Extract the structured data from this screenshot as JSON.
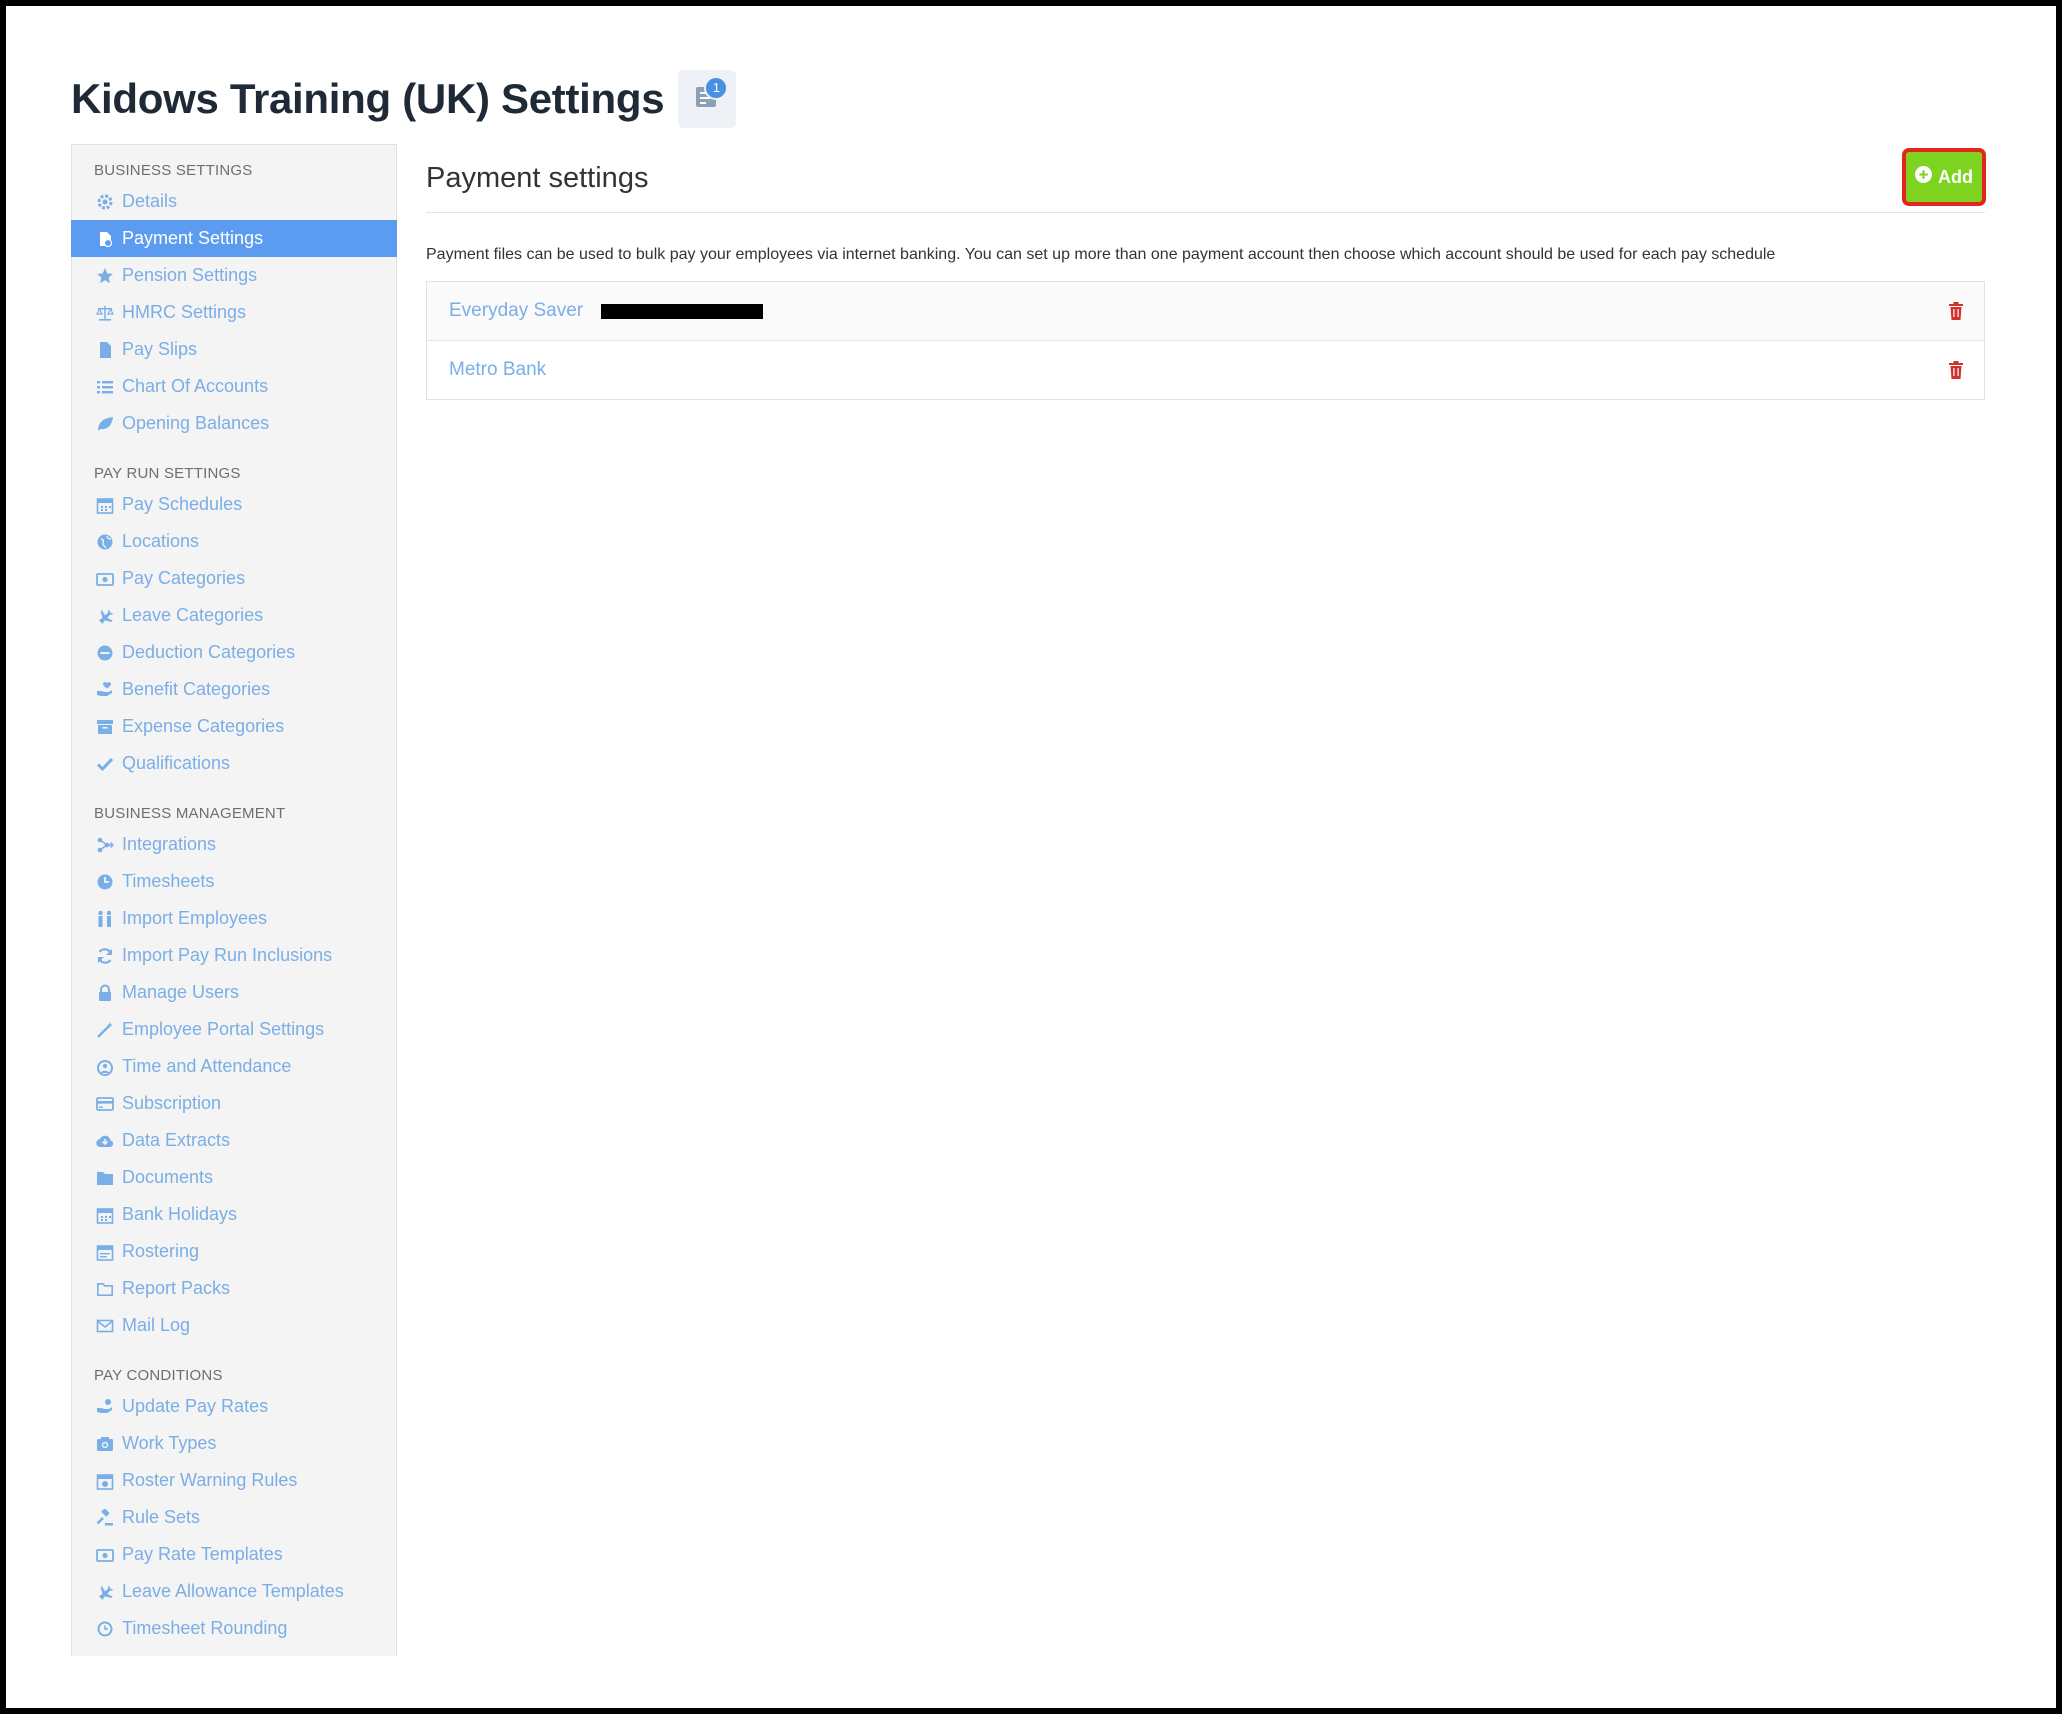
{
  "page": {
    "title": "Kidows Training (UK) Settings",
    "notification_count": "1"
  },
  "sidebar": {
    "sections": [
      {
        "title": "BUSINESS SETTINGS",
        "items": [
          {
            "label": "Details",
            "icon": "gear-icon"
          },
          {
            "label": "Payment Settings",
            "icon": "payment-settings-icon",
            "active": true
          },
          {
            "label": "Pension Settings",
            "icon": "star-icon"
          },
          {
            "label": "HMRC Settings",
            "icon": "scales-icon"
          },
          {
            "label": "Pay Slips",
            "icon": "file-icon"
          },
          {
            "label": "Chart Of Accounts",
            "icon": "list-icon"
          },
          {
            "label": "Opening Balances",
            "icon": "leaf-icon"
          }
        ]
      },
      {
        "title": "PAY RUN SETTINGS",
        "items": [
          {
            "label": "Pay Schedules",
            "icon": "calendar-icon"
          },
          {
            "label": "Locations",
            "icon": "globe-icon"
          },
          {
            "label": "Pay Categories",
            "icon": "money-icon"
          },
          {
            "label": "Leave Categories",
            "icon": "plane-icon"
          },
          {
            "label": "Deduction Categories",
            "icon": "minus-circle-icon"
          },
          {
            "label": "Benefit Categories",
            "icon": "hand-heart-icon"
          },
          {
            "label": "Expense Categories",
            "icon": "archive-icon"
          },
          {
            "label": "Qualifications",
            "icon": "check-icon"
          }
        ]
      },
      {
        "title": "BUSINESS MANAGEMENT",
        "items": [
          {
            "label": "Integrations",
            "icon": "integration-icon"
          },
          {
            "label": "Timesheets",
            "icon": "clock-icon"
          },
          {
            "label": "Import Employees",
            "icon": "users-icon"
          },
          {
            "label": "Import Pay Run Inclusions",
            "icon": "refresh-icon"
          },
          {
            "label": "Manage Users",
            "icon": "lock-icon"
          },
          {
            "label": "Employee Portal Settings",
            "icon": "wand-icon"
          },
          {
            "label": "Time and Attendance",
            "icon": "user-clock-icon"
          },
          {
            "label": "Subscription",
            "icon": "credit-card-icon"
          },
          {
            "label": "Data Extracts",
            "icon": "cloud-download-icon"
          },
          {
            "label": "Documents",
            "icon": "folder-icon"
          },
          {
            "label": "Bank Holidays",
            "icon": "calendar-icon"
          },
          {
            "label": "Rostering",
            "icon": "roster-calendar-icon"
          },
          {
            "label": "Report Packs",
            "icon": "folder-outline-icon"
          },
          {
            "label": "Mail Log",
            "icon": "envelope-icon"
          }
        ]
      },
      {
        "title": "PAY CONDITIONS",
        "items": [
          {
            "label": "Update Pay Rates",
            "icon": "hand-coin-icon"
          },
          {
            "label": "Work Types",
            "icon": "camera-icon"
          },
          {
            "label": "Roster Warning Rules",
            "icon": "calendar-warning-icon"
          },
          {
            "label": "Rule Sets",
            "icon": "gavel-icon"
          },
          {
            "label": "Pay Rate Templates",
            "icon": "money-icon"
          },
          {
            "label": "Leave Allowance Templates",
            "icon": "plane-icon"
          },
          {
            "label": "Timesheet Rounding",
            "icon": "clock-outline-icon"
          }
        ]
      }
    ]
  },
  "main": {
    "title": "Payment settings",
    "add_label": "Add",
    "description": "Payment files can be used to bulk pay your employees via internet banking. You can set up more than one payment account then choose which account should be used for each pay schedule",
    "accounts": [
      {
        "name": "Everyday Saver",
        "redacted": true
      },
      {
        "name": "Metro Bank",
        "redacted": false
      }
    ]
  },
  "colors": {
    "link": "#7aaee6",
    "active_bg": "#5b9cf0",
    "add_bg": "#7ed321",
    "add_border": "#e2261c",
    "delete": "#d0312d"
  }
}
